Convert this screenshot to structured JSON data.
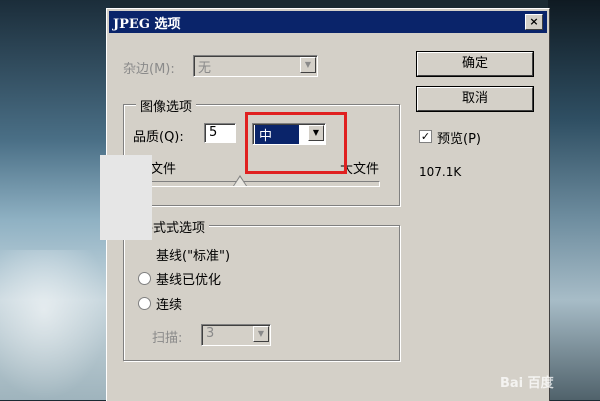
{
  "dialog": {
    "title": "JPEG 选项",
    "close_label": "×"
  },
  "matte": {
    "label": "杂边(M):",
    "value": "无"
  },
  "buttons": {
    "ok": "确定",
    "cancel": "取消"
  },
  "preview": {
    "label": "预览(P)",
    "checked": true,
    "size": "107.1K"
  },
  "image_options": {
    "title": "图像选项",
    "quality_label": "品质(Q):",
    "quality_value": "5",
    "quality_preset": "中",
    "small_file_label": "文件",
    "large_file_label": "大文件"
  },
  "format_options": {
    "title": "格式式选项",
    "baseline_standard": "基线(\"标准\")",
    "baseline_optimized": "基线已优化",
    "progressive": "连续",
    "scans_label": "扫描:",
    "scans_value": "3"
  },
  "watermark": "Bai 百度"
}
